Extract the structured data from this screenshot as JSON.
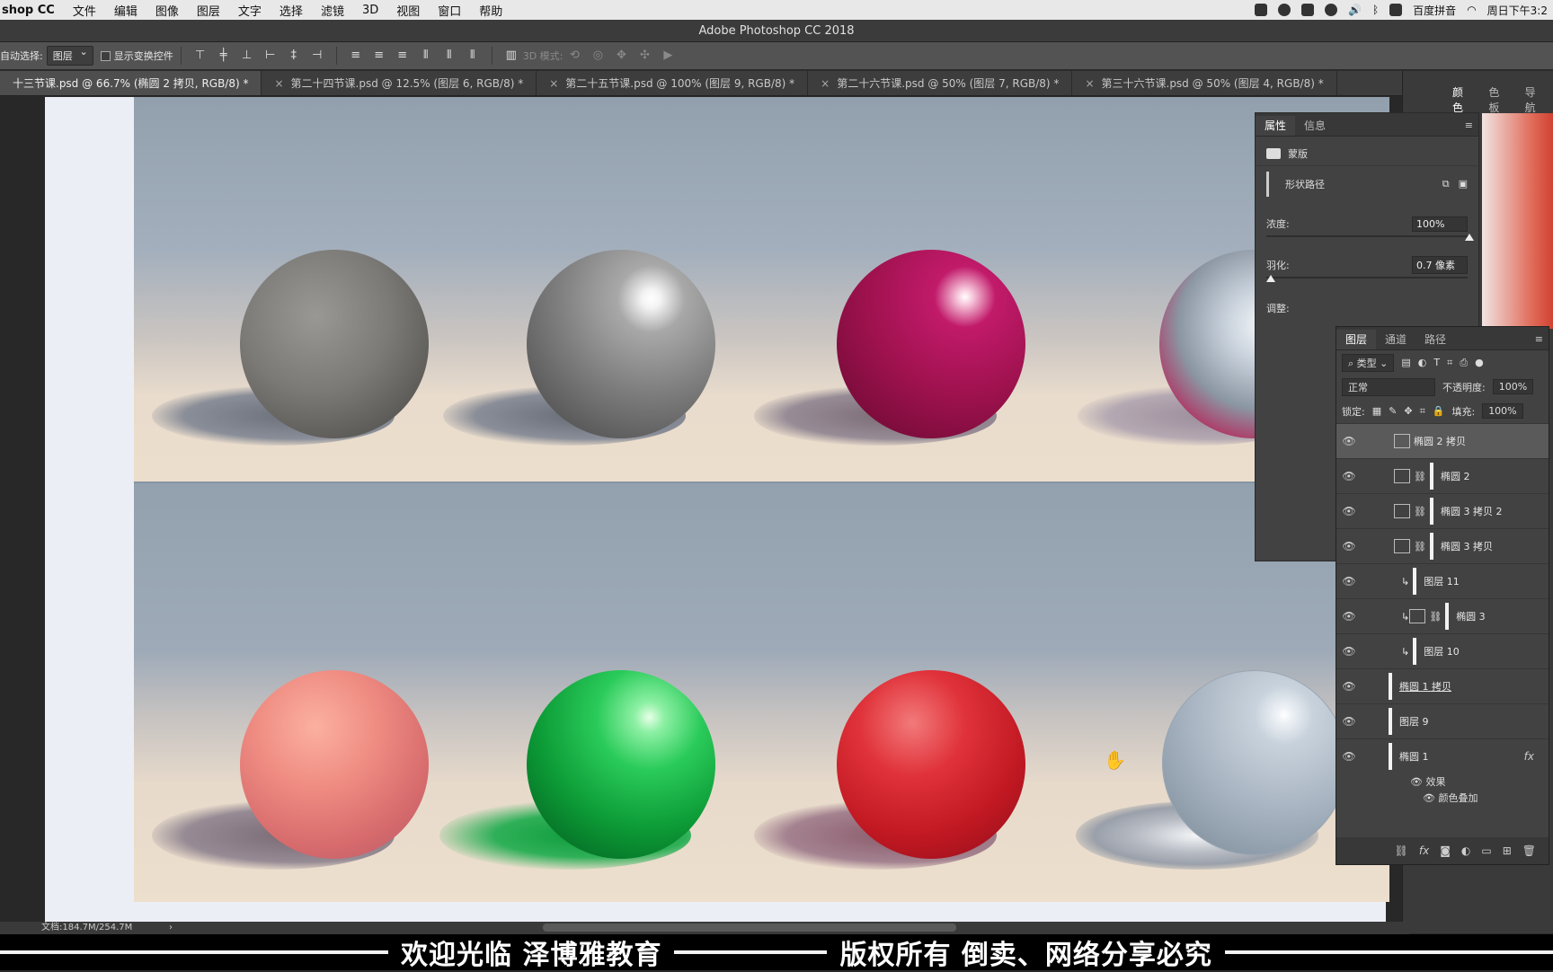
{
  "menubar": {
    "app": "shop CC",
    "items": [
      "文件",
      "编辑",
      "图像",
      "图层",
      "文字",
      "选择",
      "滤镜",
      "3D",
      "视图",
      "窗口",
      "帮助"
    ],
    "ime": "百度拼音",
    "clock": "周日下午3:2"
  },
  "window": {
    "title": "Adobe Photoshop CC 2018"
  },
  "options": {
    "auto_select_label": "自动选择:",
    "auto_select_value": "图层",
    "show_transform_label": "显示变换控件",
    "mode3d_label": "3D 模式:"
  },
  "tabs": [
    {
      "label": "十三节课.psd @ 66.7% (椭圆 2 拷贝, RGB/8) *",
      "active": true
    },
    {
      "label": "第二十四节课.psd @ 12.5% (图层 6, RGB/8) *"
    },
    {
      "label": "第二十五节课.psd @ 100% (图层 9, RGB/8) *"
    },
    {
      "label": "第二十六节课.psd @ 50% (图层 7, RGB/8) *"
    },
    {
      "label": "第三十六节课.psd @ 50% (图层 4, RGB/8) *"
    }
  ],
  "properties": {
    "tabs": [
      "属性",
      "信息"
    ],
    "mask_label": "蒙版",
    "shape_path_label": "形状路径",
    "density_label": "浓度:",
    "density_value": "100%",
    "density_level": 1.0,
    "feather_label": "羽化:",
    "feather_value": "0.7 像素",
    "feather_level": 0.0,
    "adjust_label": "调整:"
  },
  "right_panel": {
    "tabs": [
      "颜色",
      "色板",
      "导航"
    ]
  },
  "layers": {
    "tabs": [
      "图层",
      "通道",
      "路径"
    ],
    "filter_kind": "类型",
    "blend_mode": "正常",
    "opacity_label": "不透明度:",
    "opacity_value": "100%",
    "lock_label": "锁定:",
    "fill_label": "填充:",
    "fill_value": "100%",
    "rows": [
      {
        "name": "椭圆 2 拷贝",
        "selected": true
      },
      {
        "name": "椭圆 2"
      },
      {
        "name": "椭圆 3 拷贝 2"
      },
      {
        "name": "椭圆 3 拷贝"
      },
      {
        "name": "图层 11"
      },
      {
        "name": "椭圆 3"
      },
      {
        "name": "图层 10"
      },
      {
        "name": "椭圆 1 拷贝"
      },
      {
        "name": "图层 9"
      },
      {
        "name": "椭圆 1"
      }
    ],
    "effects_label": "效果",
    "color_overlay_label": "颜色叠加",
    "fx_label": "fx"
  },
  "status": {
    "doc_size": "文档:184.7M/254.7M"
  },
  "banner": {
    "left": "欢迎光临 泽博雅教育",
    "right": "版权所有 倒卖、网络分享必究"
  }
}
